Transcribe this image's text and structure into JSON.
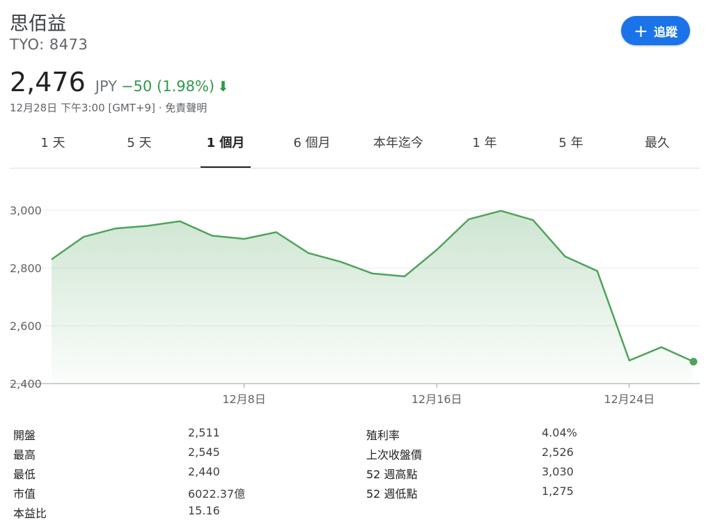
{
  "header": {
    "company_name": "思佰益",
    "ticker": "TYO: 8473",
    "follow_label": "追蹤",
    "price": "2,476",
    "currency": "JPY",
    "change": "−50 (1.98%)",
    "timestamp": "12月28日 下午3:00 [GMT+9] · ",
    "disclaimer": "免責聲明",
    "change_color": "#2e9a4b"
  },
  "tabs": [
    "1 天",
    "5 天",
    "1 個月",
    "6 個月",
    "本年迄今",
    "1 年",
    "5 年",
    "最久"
  ],
  "active_tab": "1 個月",
  "chart_data": {
    "type": "area",
    "title": "",
    "xlabel": "",
    "ylabel": "",
    "x": [
      "11/30",
      "12/1",
      "12/2",
      "12/3",
      "12/4",
      "12/7",
      "12/8",
      "12/9",
      "12/10",
      "12/11",
      "12/14",
      "12/15",
      "12/16",
      "12/17",
      "12/18",
      "12/21",
      "12/22",
      "12/23",
      "12/24",
      "12/25",
      "12/28"
    ],
    "values": [
      2830,
      2908,
      2937,
      2946,
      2962,
      2912,
      2901,
      2924,
      2852,
      2822,
      2781,
      2771,
      2863,
      2969,
      2998,
      2966,
      2840,
      2790,
      2480,
      2526,
      2476
    ],
    "y_ticks": [
      "3,000",
      "2,800",
      "2,600",
      "2,400"
    ],
    "ylim": [
      2400,
      3000
    ],
    "x_tick_labels": [
      "12月8日",
      "12月16日",
      "12月24日"
    ],
    "grid": true,
    "line_color": "#4ea35a"
  },
  "stats": {
    "left": [
      {
        "label": "開盤",
        "value": "2,511"
      },
      {
        "label": "最高",
        "value": "2,545"
      },
      {
        "label": "最低",
        "value": "2,440"
      },
      {
        "label": "市值",
        "value": "6022.37億"
      },
      {
        "label": "本益比",
        "value": "15.16"
      }
    ],
    "right": [
      {
        "label": "殖利率",
        "value": "4.04%"
      },
      {
        "label": "上次收盤價",
        "value": "2,526"
      },
      {
        "label": "52 週高點",
        "value": "3,030"
      },
      {
        "label": "52 週低點",
        "value": "1,275"
      }
    ]
  }
}
